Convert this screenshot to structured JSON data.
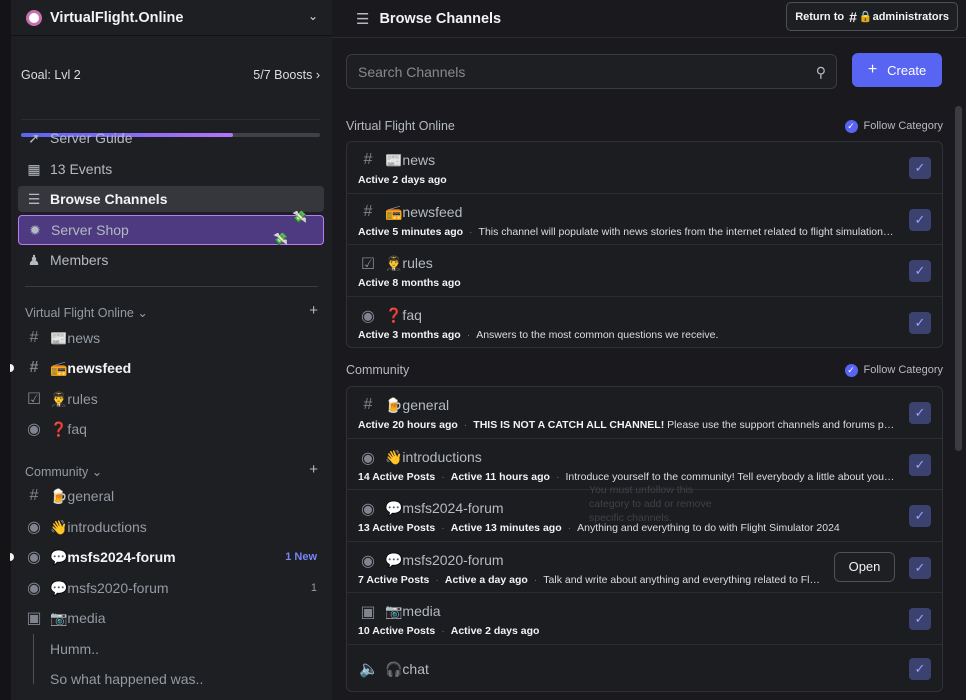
{
  "server": {
    "name": "VirtualFlight.Online"
  },
  "boost": {
    "goal": "Goal: Lvl 2",
    "count": "5/7 Boosts",
    "progress": 0.71
  },
  "nav": [
    {
      "label": "Server Guide"
    },
    {
      "label": "13 Events"
    },
    {
      "label": "Browse Channels"
    },
    {
      "label": "Server Shop"
    },
    {
      "label": "Members"
    }
  ],
  "sidebar_categories": {
    "vfo": "Virtual Flight Online",
    "community": "Community"
  },
  "sidebar_channels": {
    "news": "📰news",
    "newsfeed": "📻newsfeed",
    "rules": "👨‍✈️rules",
    "faq": "❓faq",
    "general": "🍺general",
    "introductions": "👋introductions",
    "msfs2024": "💬msfs2024-forum",
    "msfs2024_badge": "1 New",
    "msfs2020": "💬msfs2020-forum",
    "msfs2020_badge": "1",
    "media": "📷media"
  },
  "threads": [
    "Humm..",
    "So what happened was.."
  ],
  "topbar": {
    "title": "Browse Channels",
    "return_label": "Return to",
    "return_channel": "🔒administrators"
  },
  "search": {
    "placeholder": "Search Channels"
  },
  "create_label": "Create",
  "sections": [
    {
      "title": "Virtual Flight Online",
      "follow": "Follow Category",
      "rows": [
        {
          "name": "📰news",
          "meta1": "Active 2 days ago",
          "meta2": "",
          "meta3": ""
        },
        {
          "name": "📻newsfeed",
          "meta1": "Active 5 minutes ago",
          "meta2": "This channel will populate with news stories from the internet related to flight simulation. …",
          "meta3": ""
        },
        {
          "name": "👨‍✈️rules",
          "meta1": "Active 8 months ago",
          "meta2": "",
          "meta3": ""
        },
        {
          "name": "❓faq",
          "meta1": "Active 3 months ago",
          "meta2": "Answers to the most common questions we receive.",
          "meta3": ""
        }
      ]
    },
    {
      "title": "Community",
      "follow": "Follow Category",
      "rows": [
        {
          "name": "🍺general",
          "meta1": "Active 20 hours ago",
          "meta2_bold": "THIS IS NOT A CATCH ALL CHANNEL!",
          "meta2": "Please use the support channels and forums provid…",
          "meta3": ""
        },
        {
          "name": "👋introductions",
          "meta1": "14 Active Posts",
          "meta2": "Active 11 hours ago",
          "meta3": "Introduce yourself to the community! Tell everybody a little about yourself…"
        },
        {
          "name": "💬msfs2024-forum",
          "meta1": "13 Active Posts",
          "meta2": "Active 13 minutes ago",
          "meta3": "Anything and everything to do with Flight Simulator 2024"
        },
        {
          "name": "💬msfs2020-forum",
          "meta1": "7 Active Posts",
          "meta2": "Active a day ago",
          "meta3": "Talk and write about anything and everything related to Fligh…",
          "action": "Open"
        },
        {
          "name": "📷media",
          "meta1": "10 Active Posts",
          "meta2": "Active 2 days ago",
          "meta3": ""
        },
        {
          "name": "🎧chat",
          "meta1": "",
          "meta2": "",
          "meta3": ""
        }
      ]
    }
  ],
  "tooltip": "You must unfollow this category to add or remove specific channels."
}
